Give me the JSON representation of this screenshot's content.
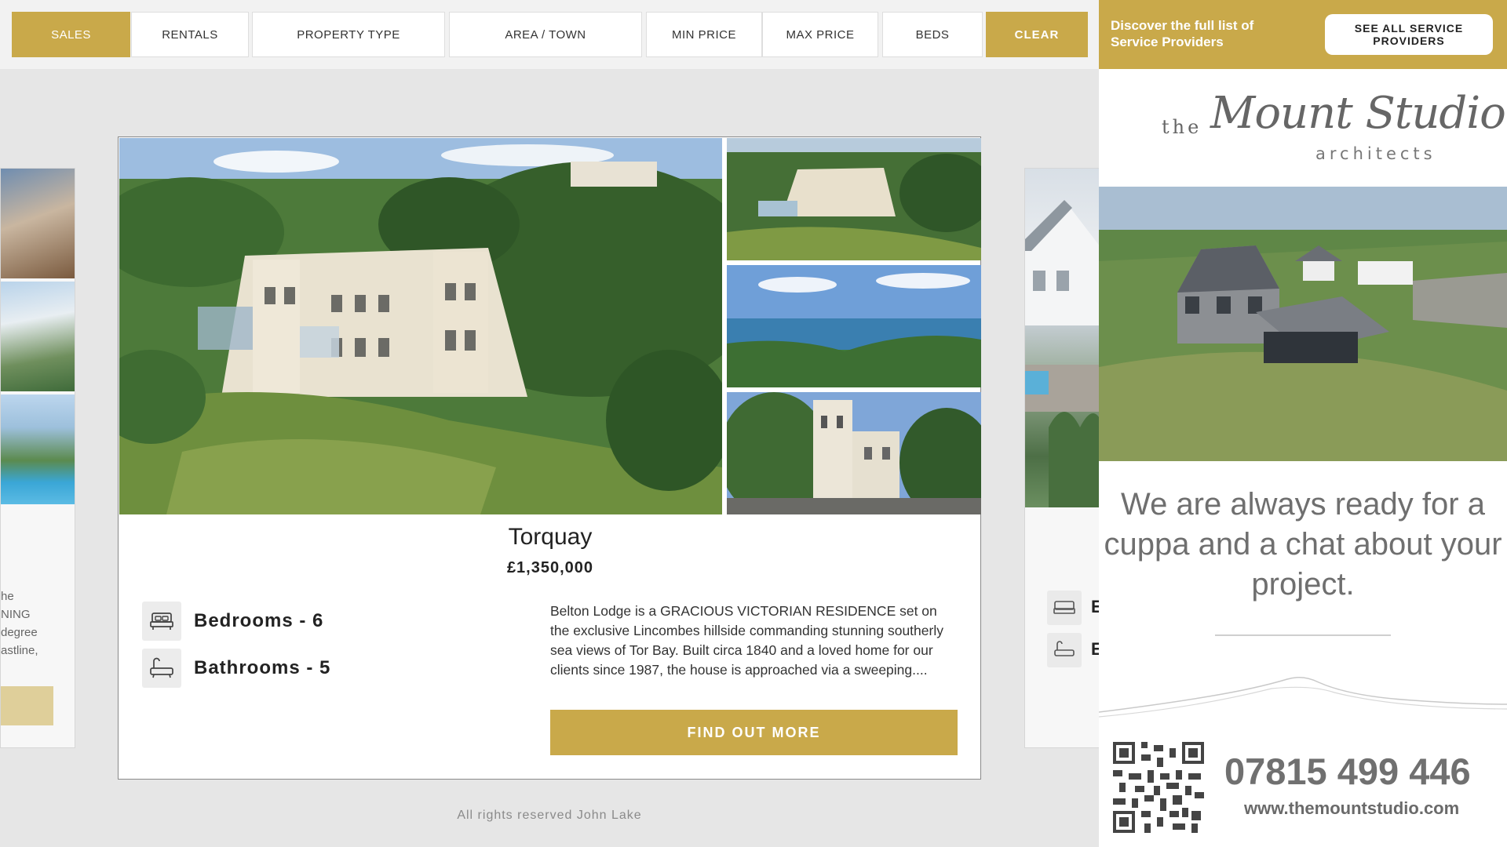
{
  "filters": {
    "sales": "SALES",
    "rentals": "RENTALS",
    "property_type": "PROPERTY TYPE",
    "area_town": "AREA / TOWN",
    "min_price": "MIN PRICE",
    "max_price": "MAX PRICE",
    "beds": "BEDS",
    "clear": "CLEAR"
  },
  "left_peek": {
    "text_lines": [
      "he",
      "NING",
      "degree",
      "astline,"
    ]
  },
  "right_peek": {
    "letters": [
      "E",
      "E"
    ]
  },
  "listing": {
    "town": "Torquay",
    "price": "£1,350,000",
    "bedrooms": "Bedrooms - 6",
    "bathrooms": "Bathrooms - 5",
    "description": "Belton Lodge is a GRACIOUS VICTORIAN RESIDENCE set on the exclusive Lincombes hillside commanding stunning southerly sea views of Tor Bay. Built circa 1840 and a loved home for our clients since 1987, the house is approached via a sweeping....",
    "cta": "FIND OUT MORE"
  },
  "footer": "All rights reserved John Lake",
  "ad": {
    "banner_text": "Discover the full list of Service Providers",
    "banner_button": "SEE ALL SERVICE PROVIDERS",
    "logo_the": "the",
    "logo_main": "Mount Studio",
    "logo_sub": "architects",
    "tagline": "We are always ready for a cuppa and a chat about your project.",
    "phone": "07815 499 446",
    "website": "www.themountstudio.com"
  },
  "colors": {
    "accent": "#c9a94a",
    "background": "#e6e6e6"
  },
  "icons": {
    "bed": "bed-icon",
    "bath": "bath-icon"
  }
}
